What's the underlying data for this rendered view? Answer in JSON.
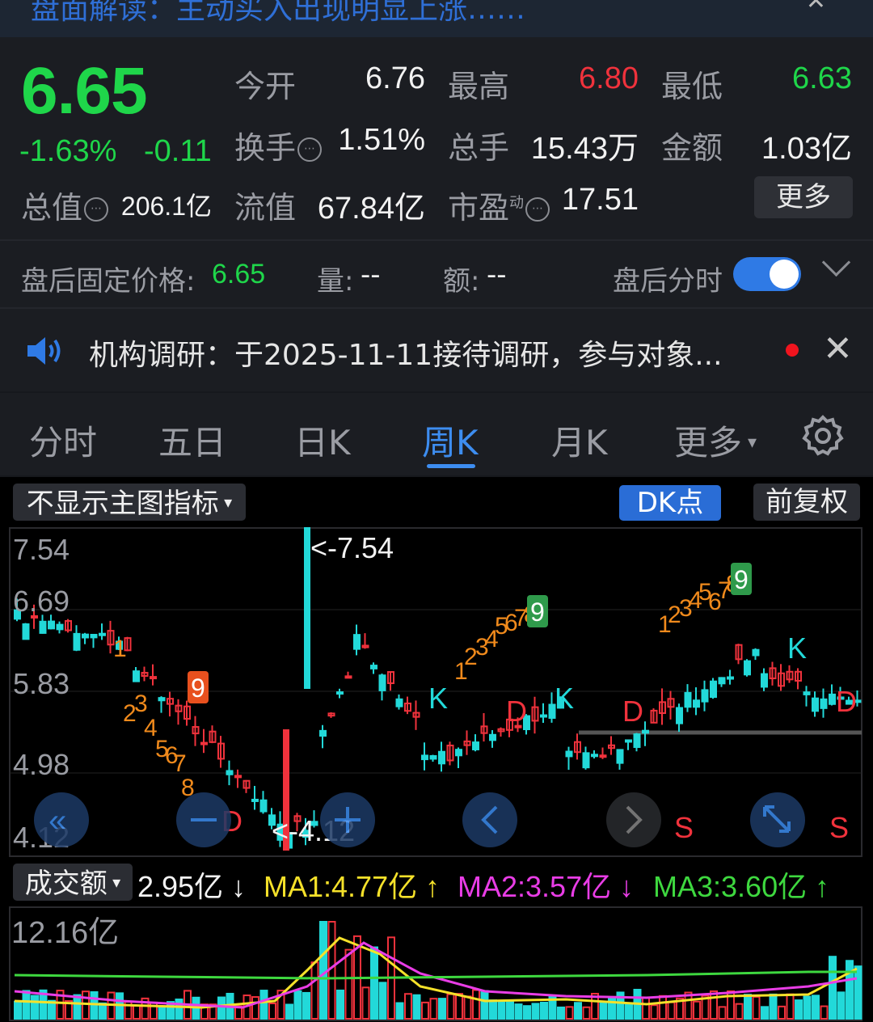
{
  "topbar": {
    "text": "盘面解读：主动买入出现明显上涨……",
    "close": "✕"
  },
  "quote": {
    "price": "6.65",
    "pct": "-1.63%",
    "change": "-0.11",
    "open_label": "今开",
    "open": "6.76",
    "high_label": "最高",
    "high": "6.80",
    "low_label": "最低",
    "low": "6.63",
    "turnover_label": "换手",
    "turnover": "1.51%",
    "volume_label": "总手",
    "volume": "15.43万",
    "amount_label": "金额",
    "amount": "1.03亿",
    "mcap_label": "总值",
    "mcap": "206.1亿",
    "float_label": "流值",
    "float": "67.84亿",
    "pe_label": "市盈",
    "pe_sup": "动",
    "pe": "17.51",
    "more": "更多",
    "info_glyph": "⋯"
  },
  "after_hours": {
    "price_label": "盘后固定价格:",
    "price": "6.65",
    "vol_label": "量:",
    "vol": "--",
    "amt_label": "额:",
    "amt": "--",
    "toggle_label": "盘后分时"
  },
  "news": {
    "text": "机构调研：于2025-11-11接待调研，参与对象..."
  },
  "tabs": [
    {
      "label": "分时"
    },
    {
      "label": "五日"
    },
    {
      "label": "日K"
    },
    {
      "label": "周K"
    },
    {
      "label": "月K"
    },
    {
      "label": "更多"
    }
  ],
  "chart_controls": {
    "indicator": "不显示主图指标",
    "dk": "DK点",
    "adjust": "前复权"
  },
  "price_axis": [
    "7.54",
    "6.69",
    "5.83",
    "4.98",
    "4.12"
  ],
  "annotations": {
    "max": "<-7.54",
    "min": "<-4.12"
  },
  "volume": {
    "selector": "成交额",
    "value": "2.95亿 ↓",
    "ma1": "MA1:4.77亿 ↑",
    "ma2": "MA2:3.57亿 ↓",
    "ma3": "MA3:3.60亿 ↑",
    "axis_max": "12.16亿"
  },
  "colors": {
    "up": "#f0323c",
    "down": "#22d9d9",
    "green": "#1fd64a",
    "accent": "#3d8df0",
    "ma1": "#f5e12a",
    "ma2": "#e93de6",
    "ma3": "#3ed83f"
  }
}
